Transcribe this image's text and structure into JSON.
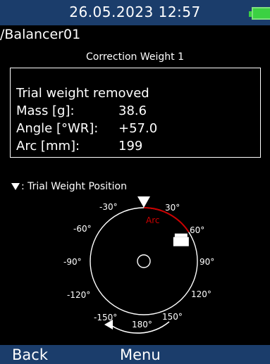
{
  "status_bar": {
    "datetime": "26.05.2023 12:57",
    "battery_icon": "battery-full-icon",
    "battery_color": "#3bd142"
  },
  "path": "/Balancer01",
  "section_title": "Correction Weight 1",
  "result": {
    "status": "Trial weight removed",
    "rows": [
      {
        "label": "Mass [g]:",
        "value": "38.6"
      },
      {
        "label": "Angle [°WR]:",
        "value": "+57.0"
      },
      {
        "label": "Arc [mm]:",
        "value": "199"
      }
    ]
  },
  "legend": {
    "symbol": "▼",
    "text": ": Trial Weight Position"
  },
  "diagram": {
    "angle_labels": [
      "-30°",
      "30°",
      "-60°",
      "60°",
      "-90°",
      "90°",
      "-120°",
      "120°",
      "-150°",
      "180°",
      "150°"
    ],
    "arc_label": "Arc",
    "arc_color": "#cc0000",
    "trial_weight_angle_deg": 0,
    "correction_weight_angle_deg": 57,
    "rotation_direction": "clockwise"
  },
  "softkeys": {
    "left": "Back",
    "center": "Menu"
  },
  "colors": {
    "header_bg": "#1b3d6b",
    "background": "#000000",
    "foreground": "#ffffff"
  }
}
